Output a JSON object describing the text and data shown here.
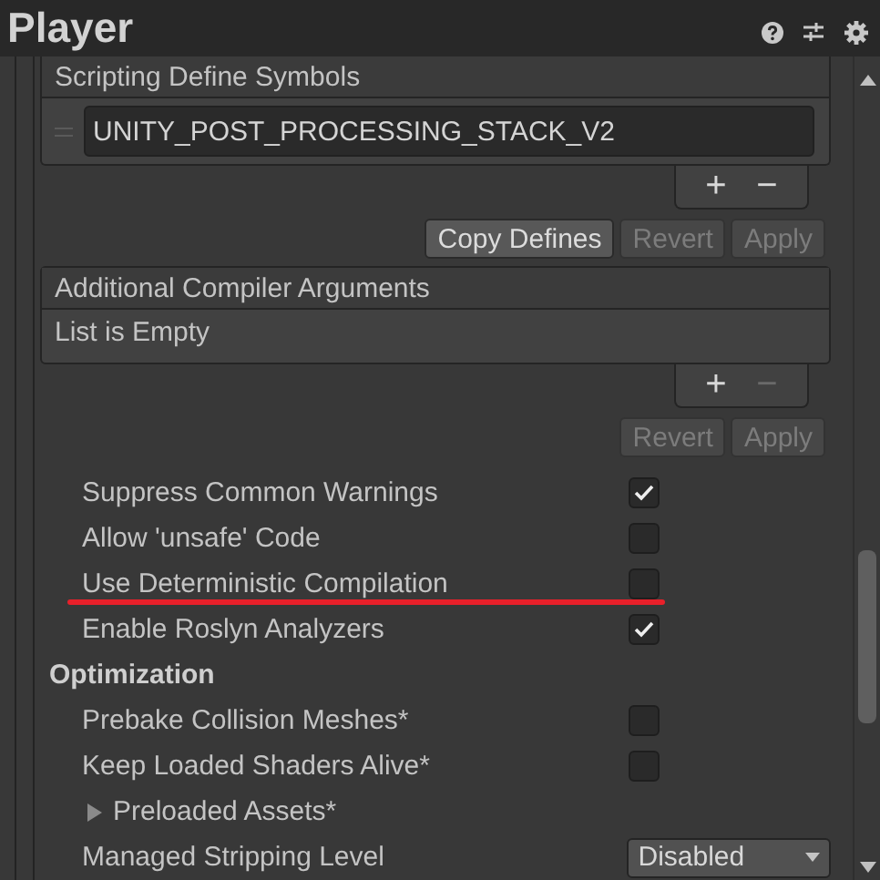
{
  "window": {
    "title": "Player"
  },
  "scripting_define_symbols": {
    "label": "Scripting Define Symbols",
    "items": [
      "UNITY_POST_PROCESSING_STACK_V2"
    ],
    "add": {
      "label": "+",
      "disabled": false
    },
    "remove": {
      "label": "−",
      "disabled": false
    },
    "buttons": [
      {
        "label": "Copy Defines",
        "disabled": false
      },
      {
        "label": "Revert",
        "disabled": true
      },
      {
        "label": "Apply",
        "disabled": true
      }
    ]
  },
  "additional_compiler_arguments": {
    "label": "Additional Compiler Arguments",
    "empty_text": "List is Empty",
    "add": {
      "label": "+",
      "disabled": false
    },
    "remove": {
      "label": "−",
      "disabled": true
    },
    "buttons": [
      {
        "label": "Revert",
        "disabled": true
      },
      {
        "label": "Apply",
        "disabled": true
      }
    ]
  },
  "settings": [
    {
      "kind": "checkbox",
      "label": "Suppress Common Warnings",
      "checked": true,
      "annotated": false
    },
    {
      "kind": "checkbox",
      "label": "Allow 'unsafe' Code",
      "checked": false,
      "annotated": false
    },
    {
      "kind": "checkbox",
      "label": "Use Deterministic Compilation",
      "checked": false,
      "annotated": true
    },
    {
      "kind": "checkbox",
      "label": "Enable Roslyn Analyzers",
      "checked": true,
      "annotated": false
    },
    {
      "kind": "section",
      "label": "Optimization"
    },
    {
      "kind": "checkbox",
      "label": "Prebake Collision Meshes*",
      "checked": false,
      "annotated": false
    },
    {
      "kind": "checkbox",
      "label": "Keep Loaded Shaders Alive*",
      "checked": false,
      "annotated": false
    },
    {
      "kind": "foldout",
      "label": "Preloaded Assets*",
      "expanded": false
    },
    {
      "kind": "dropdown",
      "label": "Managed Stripping Level",
      "value": "Disabled"
    }
  ]
}
